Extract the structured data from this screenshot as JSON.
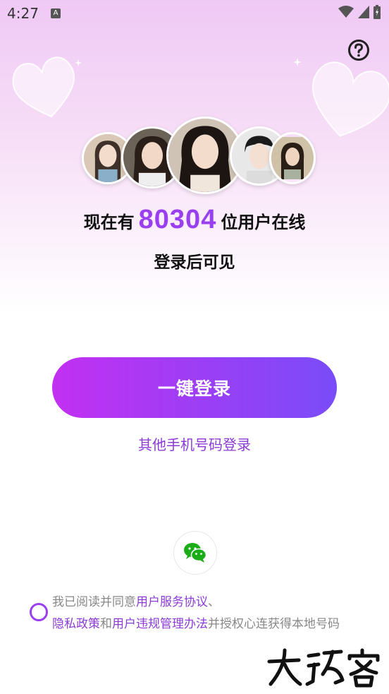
{
  "status": {
    "time": "4:27",
    "notif_glyph": "A"
  },
  "header": {
    "help_icon": "question-circle-icon"
  },
  "online": {
    "prefix": "现在有",
    "count": "80304",
    "suffix": "位用户在线"
  },
  "visible_after_login": "登录后可见",
  "login": {
    "one_click_label": "一键登录",
    "other_phone_label": "其他手机号码登录"
  },
  "social": {
    "wechat_icon": "wechat-icon"
  },
  "agreement": {
    "part1": "我已阅读并同意",
    "link1": "用户服务协议",
    "sep1": "、",
    "link2": "隐私政策",
    "and": "和",
    "link3": "用户违规管理办法",
    "part2": "并授权心连获得本地号码"
  },
  "watermark": "大玩客",
  "colors": {
    "accent": "#9a3ff0",
    "button_start": "#c230f2",
    "button_end": "#7a4cf9",
    "wechat": "#1aad19"
  }
}
